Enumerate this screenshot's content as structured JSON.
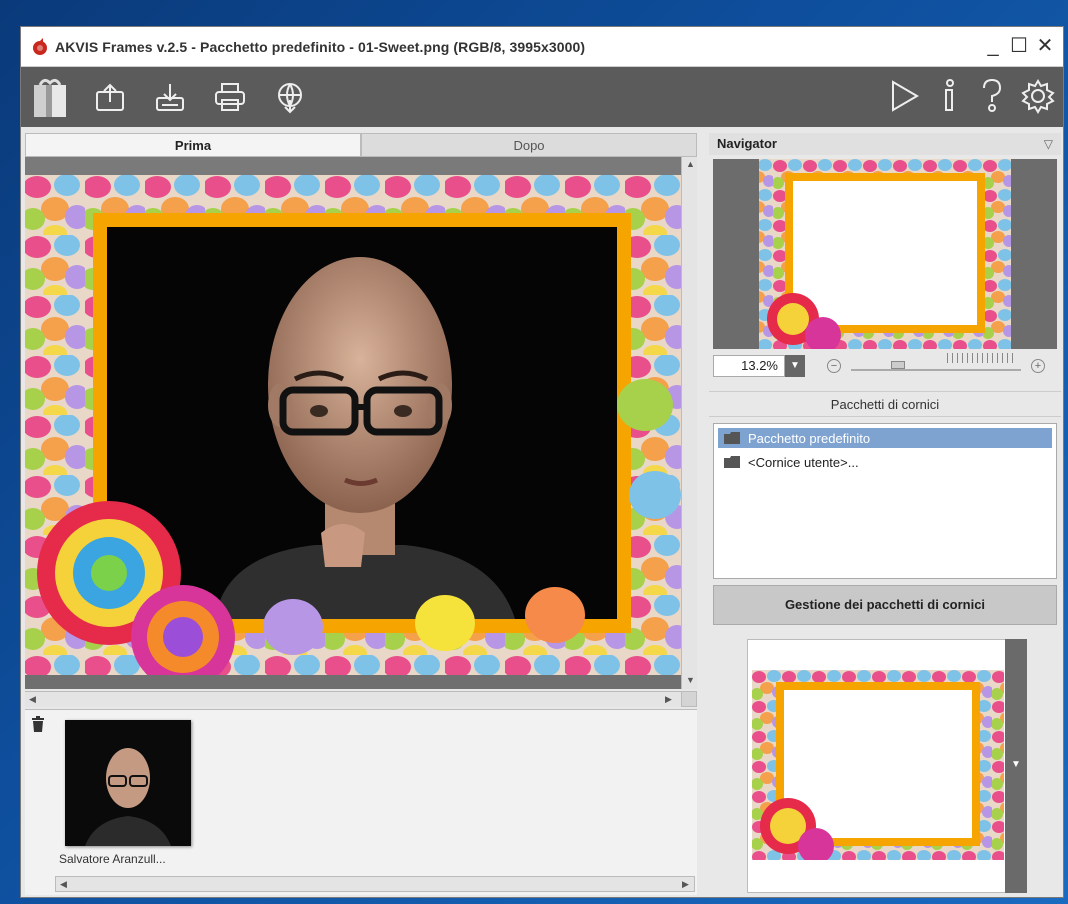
{
  "window": {
    "title": "AKVIS Frames v.2.5 - Pacchetto predefinito - 01-Sweet.png (RGB/8, 3995x3000)",
    "controls": [
      "_",
      "☐",
      "✕"
    ]
  },
  "toolbar": {
    "left_icons": [
      "gift-icon",
      "open-file-icon",
      "save-file-icon",
      "print-icon",
      "share-icon"
    ],
    "right_icons": [
      "run-icon",
      "info-icon",
      "help-icon",
      "settings-icon"
    ]
  },
  "tabs": {
    "before": "Prima",
    "after": "Dopo"
  },
  "navigator": {
    "title": "Navigator",
    "zoom": "13.2%"
  },
  "packs": {
    "header": "Pacchetti di cornici",
    "items": [
      {
        "label": "Pacchetto predefinito",
        "selected": true
      },
      {
        "label": "<Cornice utente>...",
        "selected": false
      }
    ],
    "manage_button": "Gestione dei pacchetti di cornici"
  },
  "thumbnails": [
    {
      "caption": "Salvatore Aranzull..."
    }
  ],
  "colors": {
    "toolbar_bg": "#5b5b5b",
    "selection": "#7fa3d0",
    "frame_orange": "#f5a400"
  }
}
